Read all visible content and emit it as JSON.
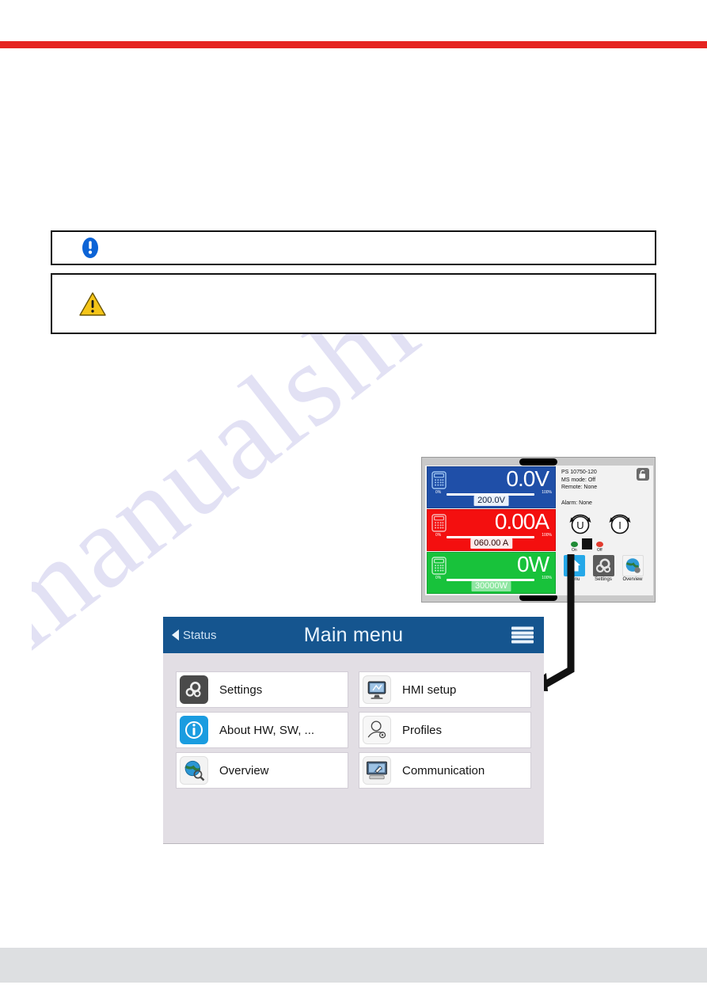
{
  "page": {
    "watermark": "manualshive.com",
    "accent_red": "#e52420",
    "accent_blue": "#15558f"
  },
  "notices": [
    {
      "id": "info",
      "icon": "info-circle-icon",
      "text": ""
    },
    {
      "id": "warning",
      "icon": "warning-triangle-icon",
      "text": ""
    }
  ],
  "device": {
    "model": "PS 10750-120",
    "ms_mode": "MS  mode: Off",
    "remote": "Remote: None",
    "alarm": "Alarm: None",
    "lock_icon": "unlocked-padlock-icon",
    "knobs": [
      {
        "name": "voltage-knob",
        "label": "U"
      },
      {
        "name": "current-knob",
        "label": "I"
      }
    ],
    "leds": [
      {
        "name": "on-led",
        "label": "On",
        "color": "#1f8a35"
      },
      {
        "name": "off-led",
        "label": "Off",
        "color": "#e23b2e"
      }
    ],
    "buttons": [
      {
        "name": "menu",
        "label": "Menu",
        "icon": "home-icon"
      },
      {
        "name": "settings",
        "label": "Settings",
        "icon": "gears-icon"
      },
      {
        "name": "overview",
        "label": "Overview",
        "icon": "globe-icon"
      }
    ],
    "values": [
      {
        "name": "voltage",
        "reading": "0.0V",
        "setpoint": "200.0V",
        "scale_min": "0%",
        "scale_max": "100%",
        "color": "#1f4fa8",
        "icon": "keypad-icon"
      },
      {
        "name": "current",
        "reading": "0.00A",
        "setpoint": "060.00 A",
        "scale_min": "0%",
        "scale_max": "100%",
        "color": "#f40f0f",
        "icon": "keypad-icon"
      },
      {
        "name": "power",
        "reading": "0W",
        "setpoint": "30000W",
        "scale_min": "0%",
        "scale_max": "100%",
        "color": "#18c23b",
        "icon": "keypad-icon"
      }
    ]
  },
  "main_menu": {
    "back_label": "Status",
    "title": "Main menu",
    "hamburger_icon": "hamburger-menu-icon",
    "tiles": [
      {
        "label": "Settings",
        "icon": "gears-icon"
      },
      {
        "label": "HMI setup",
        "icon": "monitor-star-icon"
      },
      {
        "label": "About HW, SW, ...",
        "icon": "info-circle-icon"
      },
      {
        "label": "Profiles",
        "icon": "person-gear-icon"
      },
      {
        "label": "Overview",
        "icon": "globe-magnifier-icon"
      },
      {
        "label": "Communication",
        "icon": "monitor-wrench-icon"
      }
    ]
  }
}
